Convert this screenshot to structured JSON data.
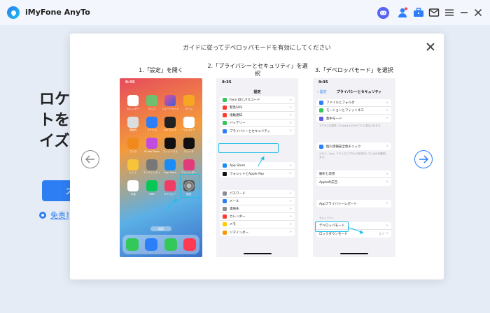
{
  "app": {
    "title": "iMyFone AnyTo"
  },
  "background": {
    "headline_lines": [
      "ロケ",
      "トを",
      "イズ"
    ],
    "button_label": "才",
    "link_text": "免责事"
  },
  "modal": {
    "title": "ガイドに従ってデベロッパモードを有効にしてください",
    "steps": [
      {
        "label": "1.「設定」を開く"
      },
      {
        "label": "2.「プライバシーとセキュリティ」を選択"
      },
      {
        "label": "3.「デベロッパモード」を選択"
      }
    ]
  },
  "phone1": {
    "time": "9:35",
    "apps": [
      "カレンダー",
      "マップ",
      "ショートカット",
      "ホーム",
      "連絡先",
      "ファイル",
      "ボイスメモ",
      "ヘルスケア",
      "ブック",
      "iTunes Store",
      "フィットネス",
      "ウォッチ",
      "ヒント",
      "ユーティリティ",
      "App Store",
      "ファインダー",
      "写真",
      "LINE",
      "ギャラリー",
      "設定"
    ],
    "pager": "検索"
  },
  "phone2": {
    "time": "9:35",
    "title": "設定",
    "group1": [
      "Face IDとパスコード",
      "緊急SOS",
      "接触通知",
      "バッテリー",
      "プライバシーとセキュリティ"
    ],
    "group2": [
      "App Store",
      "ウォレットとApple Pay"
    ],
    "group3": [
      "パスワード",
      "メール",
      "連絡先",
      "カレンダー",
      "メモ",
      "リマインダー"
    ]
  },
  "phone3": {
    "time": "9:35",
    "back": "設定",
    "title": "プライバシーとセキュリティ",
    "group1": [
      "ファイルとフォルダ",
      "モーションとフィットネス",
      "集中モード"
    ],
    "caption1": "アクセスを要求したAppは上のカテゴリに表示されます。",
    "group2": [
      "個人情報安全性チェック"
    ],
    "caption2": "どの人、App、デバイスにアクセスを許可しているかを確認します。",
    "group3": [
      "解析と改善",
      "Appleの広告"
    ],
    "group4": [
      "Appプライバシーレポート"
    ],
    "section": "セキュリティ",
    "group5": [
      "デベロッパモード",
      "ロックダウンモード"
    ],
    "lockdown_value": "オフ"
  }
}
